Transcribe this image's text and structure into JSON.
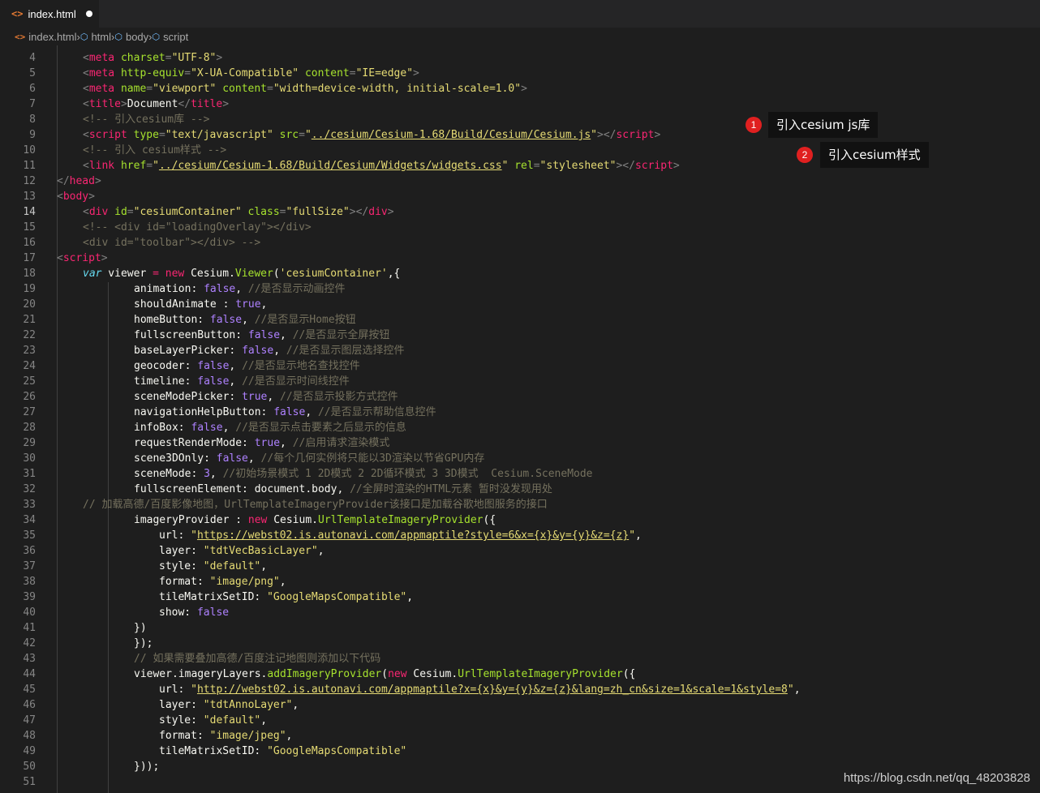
{
  "tab": {
    "label": "index.html",
    "icon": "html-file-icon"
  },
  "breadcrumb": [
    "index.html",
    "html",
    "body",
    "script"
  ],
  "annotations": [
    {
      "number": "1",
      "text": "引入cesium   js库"
    },
    {
      "number": "2",
      "text": "引入cesium样式"
    }
  ],
  "watermark": "https://blog.csdn.net/qq_48203828",
  "line_numbers": [
    "4",
    "5",
    "6",
    "7",
    "8",
    "9",
    "10",
    "11",
    "12",
    "13",
    "14",
    "15",
    "16",
    "17",
    "18",
    "19",
    "20",
    "21",
    "22",
    "23",
    "24",
    "25",
    "26",
    "27",
    "28",
    "29",
    "30",
    "31",
    "32",
    "33",
    "34",
    "35",
    "36",
    "37",
    "38",
    "39",
    "40",
    "41",
    "42",
    "43",
    "44",
    "45",
    "46",
    "47",
    "48",
    "49",
    "50",
    "51"
  ],
  "code": {
    "l4": [
      "<",
      "meta",
      " ",
      "charset",
      "=",
      "\"UTF-8\"",
      ">"
    ],
    "l5": [
      "<",
      "meta",
      " ",
      "http-equiv",
      "=",
      "\"X-UA-Compatible\"",
      " ",
      "content",
      "=",
      "\"IE=edge\"",
      ">"
    ],
    "l6": [
      "<",
      "meta",
      " ",
      "name",
      "=",
      "\"viewport\"",
      " ",
      "content",
      "=",
      "\"width=device-width, initial-scale=1.0\"",
      ">"
    ],
    "l7": [
      "<",
      "title",
      ">",
      "Document",
      "</",
      "title",
      ">"
    ],
    "l8": "<!-- 引入cesium库 -->",
    "l9": [
      "<",
      "script",
      " ",
      "type",
      "=",
      "\"text/javascript\"",
      " ",
      "src",
      "=",
      "\"",
      "../cesium/Cesium-1.68/Build/Cesium/Cesium.js",
      "\"",
      "></",
      "script",
      ">"
    ],
    "l10": "<!-- 引入 cesium样式 -->",
    "l11": [
      "<",
      "link",
      " ",
      "href",
      "=",
      "\"",
      "../cesium/Cesium-1.68/Build/Cesium/Widgets/widgets.css",
      "\"",
      " ",
      "rel",
      "=",
      "\"stylesheet\"",
      "></",
      "script",
      ">"
    ],
    "l12": [
      "</",
      "head",
      ">"
    ],
    "l13": [
      "<",
      "body",
      ">"
    ],
    "l14": [
      "<",
      "div",
      " ",
      "id",
      "=",
      "\"cesiumContainer\"",
      " ",
      "class",
      "=",
      "\"fullSize\"",
      "></",
      "div",
      ">"
    ],
    "l15": "<!-- <div id=\"loadingOverlay\"></div>",
    "l16": "<div id=\"toolbar\"></div> -->",
    "l17": [
      "<",
      "script",
      ">"
    ],
    "l18": [
      "var",
      " viewer ",
      "=",
      " ",
      "new",
      " Cesium.",
      "Viewer",
      "(",
      "'cesiumContainer'",
      ",{"
    ],
    "l19": [
      "animation: ",
      "false",
      ", ",
      "//是否显示动画控件"
    ],
    "l20": [
      "shouldAnimate : ",
      "true",
      ","
    ],
    "l21": [
      "homeButton: ",
      "false",
      ", ",
      "//是否显示Home按钮"
    ],
    "l22": [
      "fullscreenButton: ",
      "false",
      ", ",
      "//是否显示全屏按钮"
    ],
    "l23": [
      "baseLayerPicker: ",
      "false",
      ", ",
      "//是否显示图层选择控件"
    ],
    "l24": [
      "geocoder: ",
      "false",
      ", ",
      "//是否显示地名查找控件"
    ],
    "l25": [
      "timeline: ",
      "false",
      ", ",
      "//是否显示时间线控件"
    ],
    "l26": [
      "sceneModePicker: ",
      "true",
      ", ",
      "//是否显示投影方式控件"
    ],
    "l27": [
      "navigationHelpButton: ",
      "false",
      ", ",
      "//是否显示帮助信息控件"
    ],
    "l28": [
      "infoBox: ",
      "false",
      ", ",
      "//是否显示点击要素之后显示的信息"
    ],
    "l29": [
      "requestRenderMode: ",
      "true",
      ", ",
      "//启用请求渲染模式"
    ],
    "l30": [
      "scene3DOnly: ",
      "false",
      ", ",
      "//每个几何实例将只能以3D渲染以节省GPU内存"
    ],
    "l31": [
      "sceneMode: ",
      "3",
      ", ",
      "//初始场景模式 1 2D模式 2 2D循环模式 3 3D模式  Cesium.SceneMode"
    ],
    "l32": [
      "fullscreenElement: document.body, ",
      "//全屏时渲染的HTML元素 暂时没发现用处"
    ],
    "l33": "// 加载高德/百度影像地图，UrlTemplateImageryProvider该接口是加载谷歌地图服务的接口",
    "l34": [
      "imageryProvider : ",
      "new",
      " Cesium.",
      "UrlTemplateImageryProvider",
      "({"
    ],
    "l35": [
      "url: ",
      "\"",
      "https://webst02.is.autonavi.com/appmaptile?style=6&x={x}&y={y}&z={z}",
      "\"",
      ","
    ],
    "l36": [
      "layer: ",
      "\"tdtVecBasicLayer\"",
      ","
    ],
    "l37": [
      "style: ",
      "\"default\"",
      ","
    ],
    "l38": [
      "format: ",
      "\"image/png\"",
      ","
    ],
    "l39": [
      "tileMatrixSetID: ",
      "\"GoogleMapsCompatible\"",
      ","
    ],
    "l40": [
      "show: ",
      "false"
    ],
    "l41": "})",
    "l42": "});",
    "l43": "// 如果需要叠加高德/百度注记地图则添加以下代码",
    "l44": [
      "viewer.imageryLayers.",
      "addImageryProvider",
      "(",
      "new",
      " Cesium.",
      "UrlTemplateImageryProvider",
      "({"
    ],
    "l45": [
      "url: ",
      "\"",
      "http://webst02.is.autonavi.com/appmaptile?x={x}&y={y}&z={z}&lang=zh_cn&size=1&scale=1&style=8",
      "\"",
      ","
    ],
    "l46": [
      "layer: ",
      "\"tdtAnnoLayer\"",
      ","
    ],
    "l47": [
      "style: ",
      "\"default\"",
      ","
    ],
    "l48": [
      "format: ",
      "\"image/jpeg\"",
      ","
    ],
    "l49": [
      "tileMatrixSetID: ",
      "\"GoogleMapsCompatible\""
    ],
    "l50": "}));",
    "l51": ""
  }
}
